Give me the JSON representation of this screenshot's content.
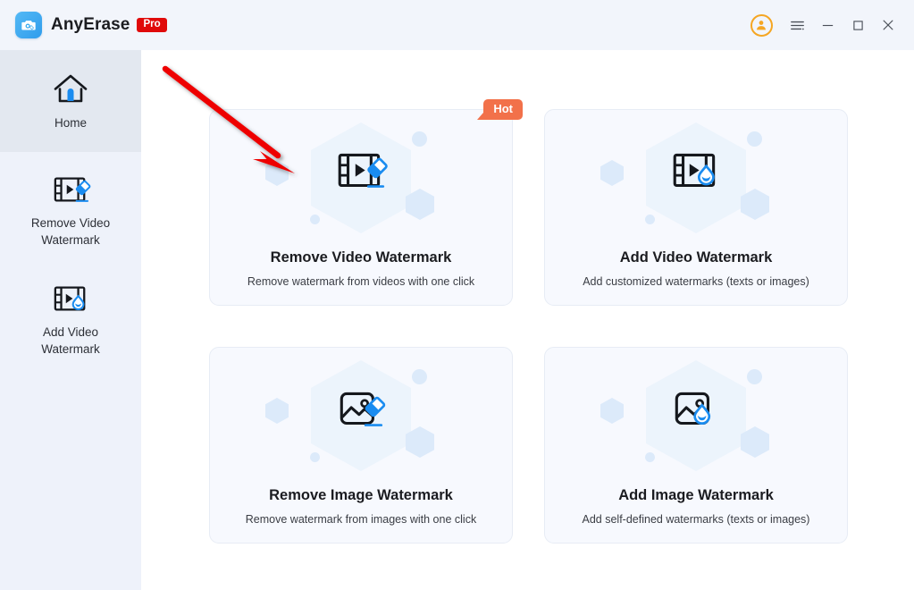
{
  "window": {
    "app_name": "AnyErase",
    "edition_badge": "Pro",
    "logo_icon": "camera-eraser-icon",
    "controls": [
      {
        "name": "user-account-button",
        "icon": "user-avatar-icon",
        "label": ""
      },
      {
        "name": "menu-button",
        "icon": "hamburger-menu-icon",
        "label": ""
      },
      {
        "name": "minimize-button",
        "icon": "minimize-icon",
        "label": ""
      },
      {
        "name": "maximize-button",
        "icon": "maximize-icon",
        "label": ""
      },
      {
        "name": "close-button",
        "icon": "close-icon",
        "label": ""
      }
    ]
  },
  "colors": {
    "titlebar_bg": "#f2f5fb",
    "sidebar_bg": "#eef2fa",
    "sidebar_active_bg": "#e3e8f0",
    "card_bg": "#f7f9fe",
    "card_border": "#e7ecf5",
    "accent_blue": "#1a8cf0",
    "logo_blue": "#3aabf0",
    "pro_red": "#e00a0a",
    "hot_orange": "#f2714a",
    "avatar_orange": "#f5a623",
    "annotation_red": "#ee0000",
    "hex_decoration": "#dceafa",
    "text_primary": "#1b1c20"
  },
  "sidebar": {
    "items": [
      {
        "label": "Home",
        "icon": "home-icon",
        "active": true
      },
      {
        "label": "Remove Video Watermark",
        "icon": "video-eraser-icon",
        "active": false
      },
      {
        "label": "Add Video Watermark",
        "icon": "video-droplet-icon",
        "active": false
      }
    ]
  },
  "main": {
    "cards": [
      {
        "title": "Remove Video Watermark",
        "subtitle": "Remove watermark from videos with one click",
        "icon": "video-eraser-icon",
        "badge": "Hot"
      },
      {
        "title": "Add Video Watermark",
        "subtitle": "Add customized watermarks (texts or images)",
        "icon": "video-droplet-icon",
        "badge": ""
      },
      {
        "title": "Remove Image Watermark",
        "subtitle": "Remove watermark from images with one click",
        "icon": "image-eraser-icon",
        "badge": ""
      },
      {
        "title": "Add Image Watermark",
        "subtitle": "Add self-defined watermarks  (texts or images)",
        "icon": "image-droplet-icon",
        "badge": ""
      }
    ]
  },
  "annotation": {
    "arrow": "red-pointer-arrow",
    "points_at": "Remove Video Watermark"
  }
}
